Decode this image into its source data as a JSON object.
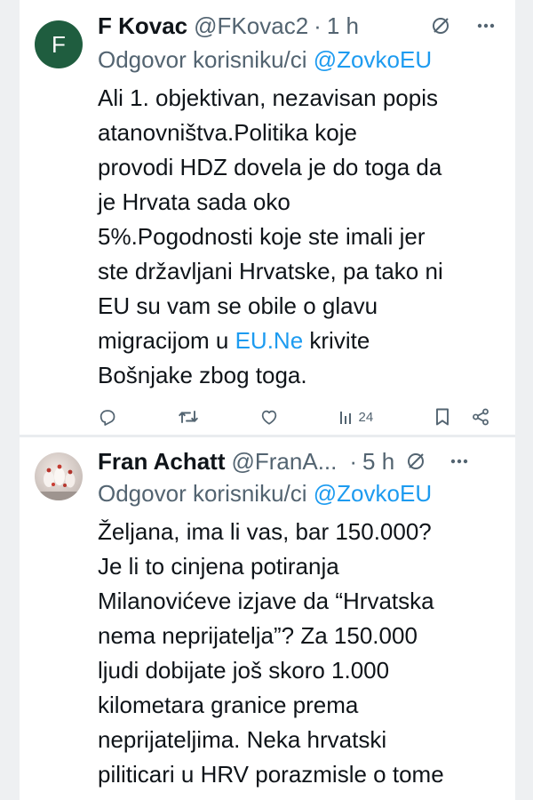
{
  "tweets": [
    {
      "avatar_letter": "F",
      "name": "F Kovac",
      "handle": "@FKovac2",
      "separator": "·",
      "time": "1 h",
      "reply_prefix": "Odgovor korisniku/ci",
      "reply_mention": "@ZovkoEU",
      "body_lines": [
        "Ali 1. objektivan, nezavisan popis",
        "atanovništva.Politika koje",
        "provodi HDZ dovela je do toga da",
        "je Hrvata sada oko",
        "5%.Pogodnosti koje ste imali jer",
        "ste državljani Hrvatske, pa tako ni",
        "EU su vam se obile o glavu"
      ],
      "body_line8_before": "migracijom u ",
      "body_link": "EU.Ne",
      "body_line8_after": " krivite",
      "body_line9": "Bošnjake zbog toga.",
      "views": "24",
      "icons": [
        "reply-icon",
        "retweet-icon",
        "like-icon",
        "views-icon",
        "bookmark-icon",
        "share-icon",
        "grok-icon",
        "more-icon"
      ]
    },
    {
      "name": "Fran Achatt",
      "handle": "@FranA...",
      "separator": "·",
      "time": "5 h",
      "reply_prefix": "Odgovor korisniku/ci",
      "reply_mention": "@ZovkoEU",
      "body_lines": [
        "Željana, ima li vas, bar 150.000?",
        "Je li to cinjena potiranja",
        "Milanovićeve izjave da “Hrvatska",
        "nema neprijatelja”? Za 150.000",
        "ljudi dobijate još skoro 1.000",
        "kilometara granice prema",
        "neprijateljima. Neka hrvatski",
        "piliticari u HRV porazmisle o tome"
      ]
    }
  ],
  "colors": {
    "accent": "#1d9bf0",
    "text": "#0f1419",
    "secondary": "#536471",
    "avatar_bg": "#1f5d3f"
  }
}
